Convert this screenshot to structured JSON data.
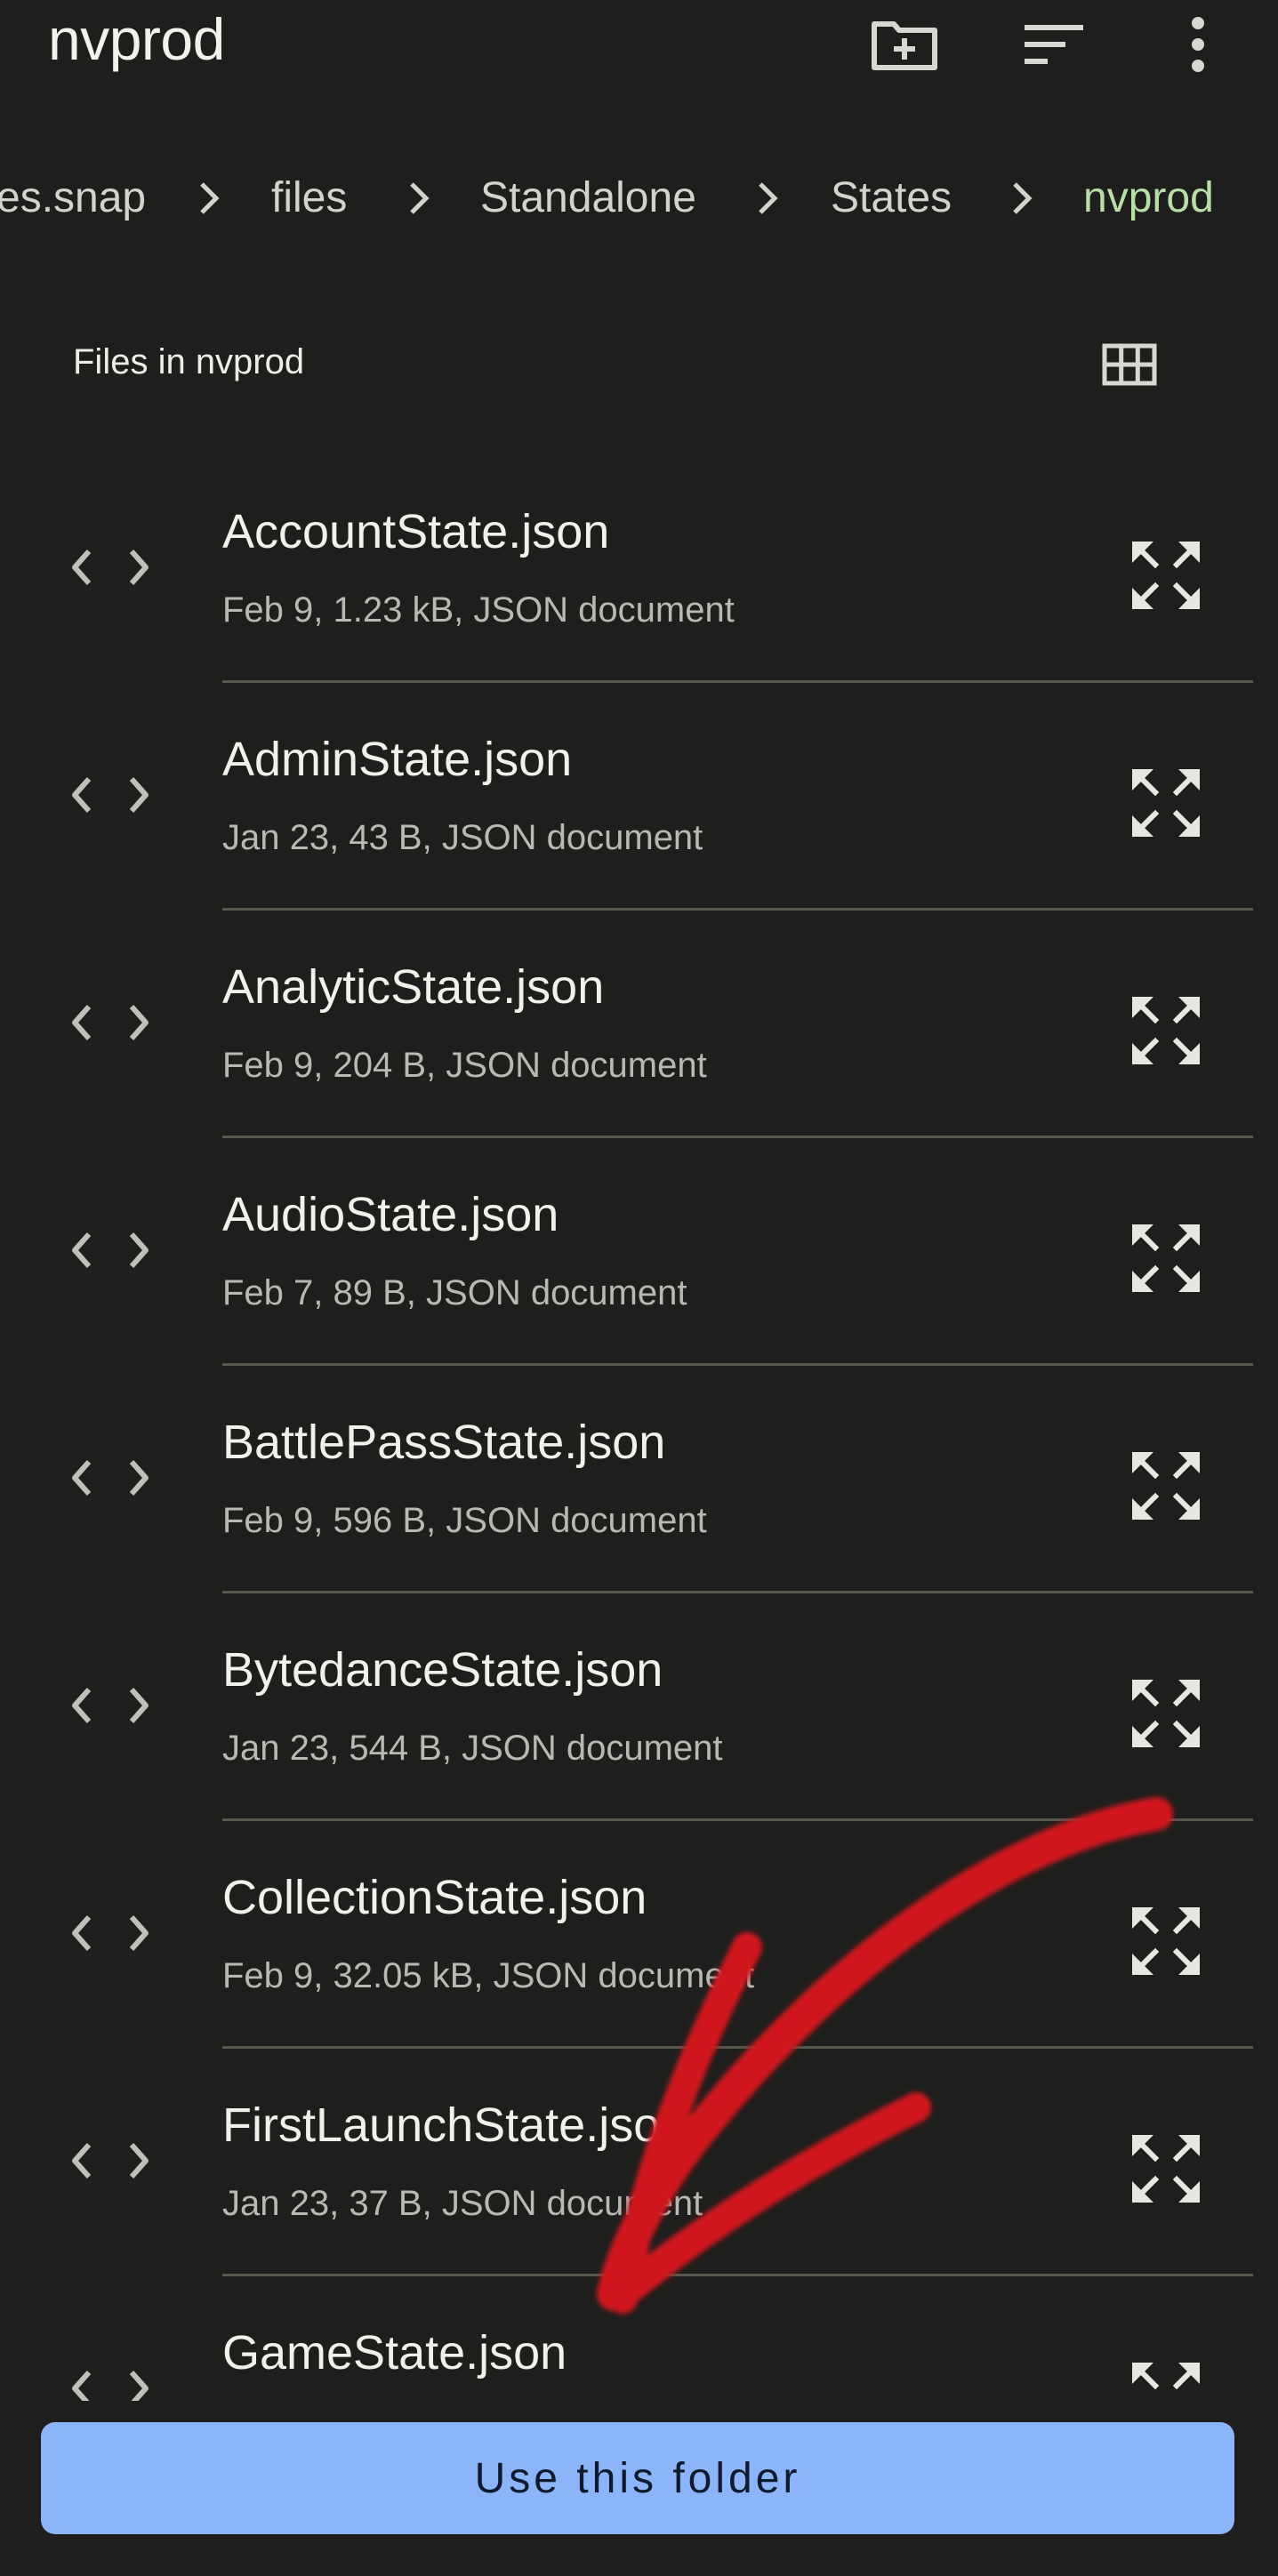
{
  "app": {
    "title": "nvprod"
  },
  "toolbar": {
    "icons": [
      "new-folder-icon",
      "sort-icon",
      "more-vert-icon"
    ]
  },
  "breadcrumb": {
    "items": [
      "es.snap",
      "files",
      "Standalone",
      "States",
      "nvprod"
    ],
    "current_color": "#b9dfa6"
  },
  "section": {
    "title": "Files in nvprod",
    "view_toggle_icon": "grid-view-icon"
  },
  "files": [
    {
      "name": "AccountState.json",
      "meta": "Feb 9, 1.23 kB, JSON document"
    },
    {
      "name": "AdminState.json",
      "meta": "Jan 23, 43 B, JSON document"
    },
    {
      "name": "AnalyticState.json",
      "meta": "Feb 9, 204 B, JSON document"
    },
    {
      "name": "AudioState.json",
      "meta": "Feb 7, 89 B, JSON document"
    },
    {
      "name": "BattlePassState.json",
      "meta": "Feb 9, 596 B, JSON document"
    },
    {
      "name": "BytedanceState.json",
      "meta": "Jan 23, 544 B, JSON document"
    },
    {
      "name": "CollectionState.json",
      "meta": "Feb 9, 32.05 kB, JSON document"
    },
    {
      "name": "FirstLaunchState.json",
      "meta": "Jan 23, 37 B, JSON document"
    },
    {
      "name": "GameState.json",
      "meta": ""
    }
  ],
  "actions": {
    "use_folder_label": "Use this folder"
  },
  "colors": {
    "background": "#1e1f1d",
    "accent_button": "#8cb4f8",
    "annotation_arrow": "#d0141c"
  }
}
